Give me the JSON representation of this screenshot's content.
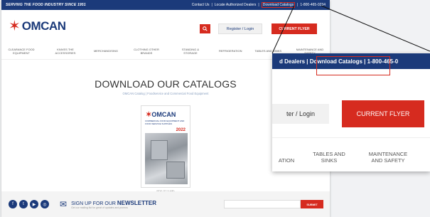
{
  "topbar": {
    "tagline": "SERVING THE FOOD INDUSTRY SINCE 1951",
    "links": [
      "Contact Us",
      "|",
      "Locate Authorized Dealers",
      "|",
      "Download Catalogs",
      "|",
      "1-800-465-0234"
    ]
  },
  "header": {
    "logo_text": "OMCAN",
    "search_icon": "search-icon",
    "register_label": "Register / Login",
    "flyer_label": "CURRENT FLYER"
  },
  "nav": {
    "items": [
      "CLEARANCE FOOD EQUIPMENT",
      "KNIVES THE ACCESSORIES",
      "MERCHANDISING",
      "CLOTHING OTHER BRANDS",
      "STANDING & STORAGE",
      "REFRIGERATION",
      "TABLES AND SINKS",
      "MAINTENANCE AND SAFETY"
    ]
  },
  "main": {
    "title": "DOWNLOAD OUR CATALOGS",
    "breadcrumb": "OMCAN Catalog | Foodservice and Commercial Food Equipment",
    "catalog": {
      "logo": "OMCAN",
      "subtitle": "COMMERCIAL FOOD EQUIPMENT AND FOOD SERVICE SUPPLIES",
      "year": "2022"
    },
    "file_size": "PDF (32.5 MB)"
  },
  "footer": {
    "social_icons": [
      "facebook-icon",
      "twitter-icon",
      "youtube-icon",
      "instagram-icon"
    ],
    "newsletter_prefix": "SIGN UP FOR OUR ",
    "newsletter_bold": "NEWSLETTER",
    "newsletter_sub": "Get our mailing list for great of updates and promos",
    "submit_label": "SUBMIT"
  },
  "zoom": {
    "bar_text": "d Dealers | Download Catalogs | 1-800-465-0",
    "register_label": "ter / Login",
    "flyer_label": "CURRENT FLYER",
    "nav": [
      {
        "label": "ATION"
      },
      {
        "label": "TABLES AND SINKS"
      },
      {
        "label": "MAINTENANCE AND SAFETY"
      }
    ]
  },
  "colors": {
    "brand_blue": "#1b3a7a",
    "brand_red": "#d62b1f"
  }
}
